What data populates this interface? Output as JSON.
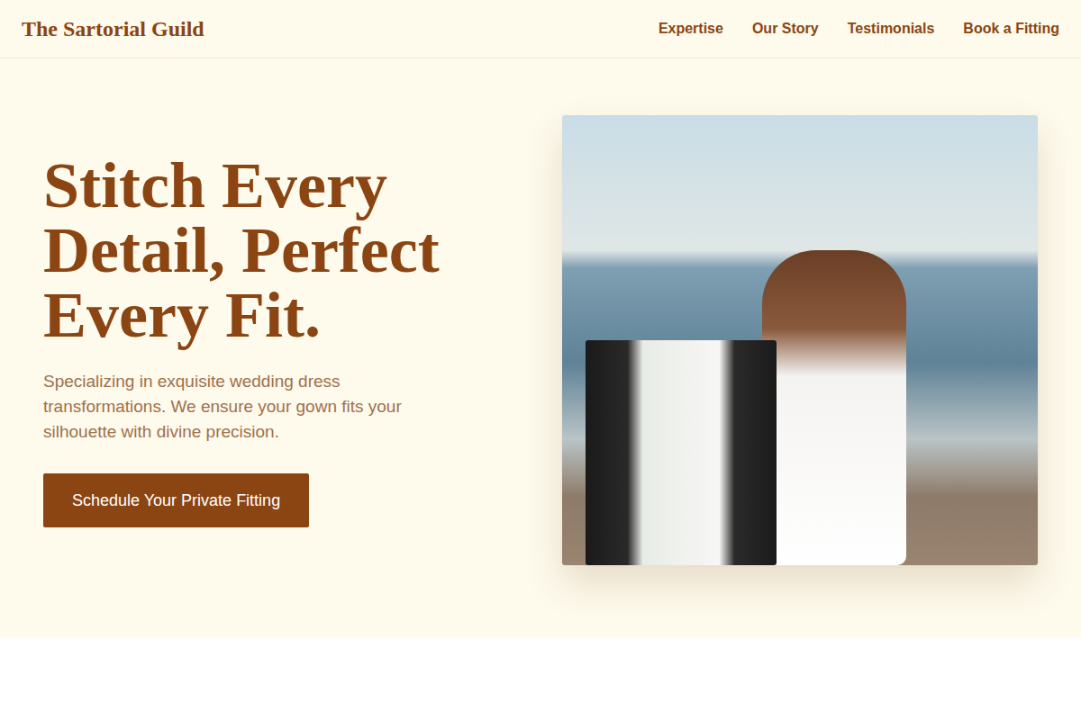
{
  "header": {
    "brand": "The Sartorial Guild",
    "nav": [
      {
        "label": "Expertise"
      },
      {
        "label": "Our Story"
      },
      {
        "label": "Testimonials"
      },
      {
        "label": "Book a Fitting"
      }
    ]
  },
  "hero": {
    "heading": "Stitch Every Detail, Perfect Every Fit.",
    "description": "Specializing in exquisite wedding dress transformations. We ensure your gown fits your silhouette with divine precision.",
    "cta": "Schedule Your Private Fitting"
  }
}
